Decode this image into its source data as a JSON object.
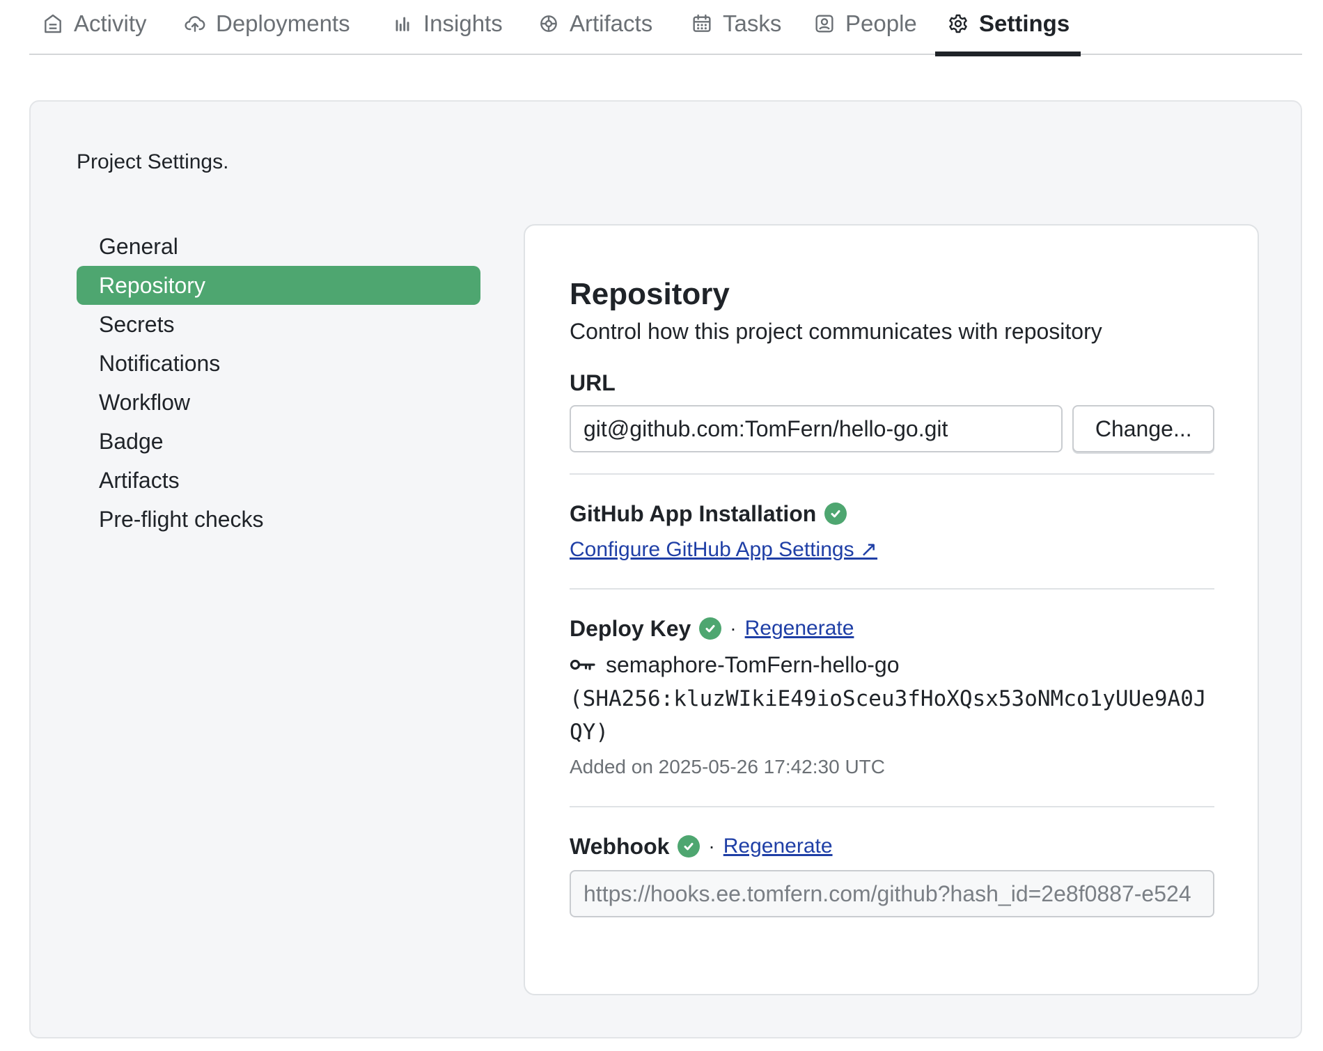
{
  "tabs": [
    {
      "label": "Activity",
      "icon": "activity-icon"
    },
    {
      "label": "Deployments",
      "icon": "cloud-upload-icon"
    },
    {
      "label": "Insights",
      "icon": "bar-chart-icon"
    },
    {
      "label": "Artifacts",
      "icon": "artifacts-icon"
    },
    {
      "label": "Tasks",
      "icon": "calendar-icon"
    },
    {
      "label": "People",
      "icon": "person-icon"
    },
    {
      "label": "Settings",
      "icon": "gear-icon",
      "active": true
    }
  ],
  "panel": {
    "title": "Project Settings."
  },
  "sidenav": {
    "items": [
      {
        "label": "General"
      },
      {
        "label": "Repository",
        "active": true
      },
      {
        "label": "Secrets"
      },
      {
        "label": "Notifications"
      },
      {
        "label": "Workflow"
      },
      {
        "label": "Badge"
      },
      {
        "label": "Artifacts"
      },
      {
        "label": "Pre-flight checks"
      }
    ]
  },
  "repository": {
    "title": "Repository",
    "subtitle": "Control how this project communicates with repository",
    "url_label": "URL",
    "url_value": "git@github.com:TomFern/hello-go.git",
    "change_button": "Change...",
    "github_app": {
      "label": "GitHub App Installation",
      "configure_link": "Configure GitHub App Settings ↗"
    },
    "deploy_key": {
      "label": "Deploy Key",
      "separator": "·",
      "regenerate": "Regenerate",
      "name": "semaphore-TomFern-hello-go",
      "fingerprint": "(SHA256:kluzWIkiE49ioSceu3fHoXQsx53oNMco1yUUe9A0JQY)",
      "added": "Added on 2025-05-26 17:42:30 UTC"
    },
    "webhook": {
      "label": "Webhook",
      "separator": "·",
      "regenerate": "Regenerate",
      "url": "https://hooks.ee.tomfern.com/github?hash_id=2e8f0887-e524"
    }
  },
  "colors": {
    "accent_green": "#4ea670",
    "link_blue": "#1f3fa6",
    "text": "#1f2328",
    "muted": "#6b7075"
  }
}
